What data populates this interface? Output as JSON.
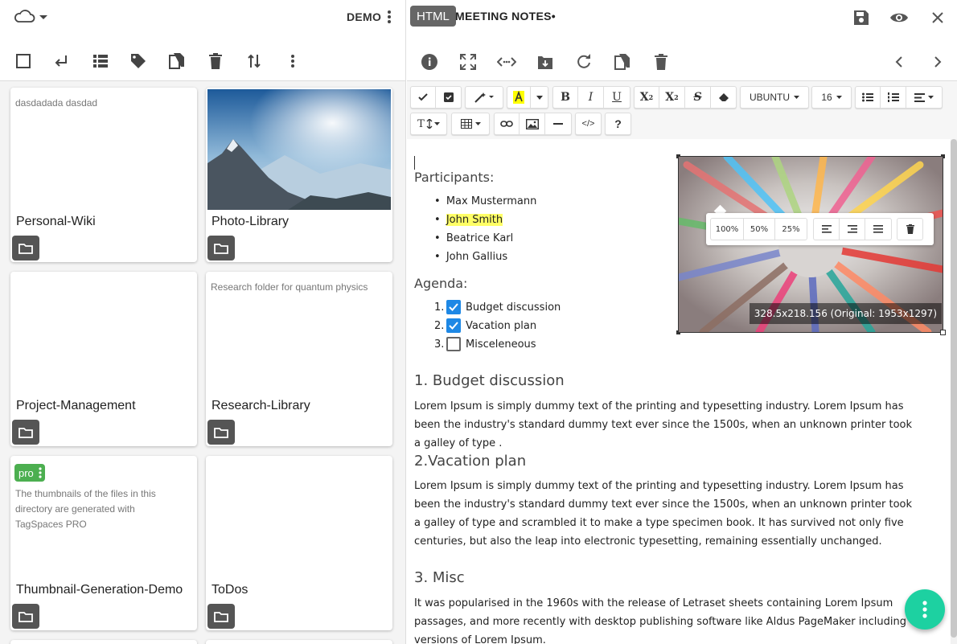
{
  "left_panel": {
    "location_name": "DEMO",
    "cards": [
      {
        "title": "Personal-Wiki",
        "description": "dasdadada dasdad"
      },
      {
        "title": "Photo-Library",
        "description": ""
      },
      {
        "title": "Project-Management",
        "description": ""
      },
      {
        "title": "Research-Library",
        "description": "Research folder for quantum physics"
      },
      {
        "title": "Thumbnail-Generation-Demo",
        "description": "The thumbnails of the files in this\ndirectory are generated with\nTagSpaces PRO",
        "badge": "pro"
      },
      {
        "title": "ToDos",
        "description": ""
      }
    ]
  },
  "file": {
    "type_tag": "HTML",
    "title": "MEETING NOTES•"
  },
  "editor_toolbar": {
    "font_family": "UBUNTU",
    "font_size": "16"
  },
  "image_popup": {
    "sizes": [
      "100%",
      "50%",
      "25%"
    ],
    "dimensions": "328.5x218.156 (Original: 1953x1297)"
  },
  "document": {
    "participants_heading": "Participants:",
    "participants": [
      "Max Mustermann",
      "John Smith",
      "Beatrice Karl",
      "John Gallius"
    ],
    "agenda_heading": "Agenda:",
    "agenda": [
      {
        "num": "1.",
        "label": "Budget discussion",
        "checked": true
      },
      {
        "num": "2.",
        "label": "Vacation plan",
        "checked": true
      },
      {
        "num": "3.",
        "label": "Misceleneous",
        "checked": false
      }
    ],
    "sections": [
      {
        "heading": "1. Budget discussion",
        "text": "Lorem Ipsum is simply dummy text of the printing and typesetting industry. Lorem Ipsum has been the industry's standard dummy text ever since the 1500s, when an unknown printer took a galley of type ."
      },
      {
        "heading": "2.Vacation plan",
        "text": "Lorem Ipsum is simply dummy text of the printing and typesetting industry.  Lorem Ipsum has been the industry's standard dummy text ever since the 1500s, when an unknown printer took a galley of type and scrambled it to make a type specimen book. It has survived not only five centuries, but also the leap into electronic typesetting, remaining essentially unchanged."
      },
      {
        "heading": "3. Misc",
        "text": "It was popularised in the 1960s with the release of Letraset sheets containing Lorem Ipsum passages, and more recently with desktop publishing software like Aldus PageMaker including versions of Lorem Ipsum."
      }
    ]
  },
  "colors": {
    "accent": "#1dd1a1",
    "checkbox": "#1e88e5",
    "highlight": "#ffff66",
    "pro_badge": "#4caf50"
  }
}
